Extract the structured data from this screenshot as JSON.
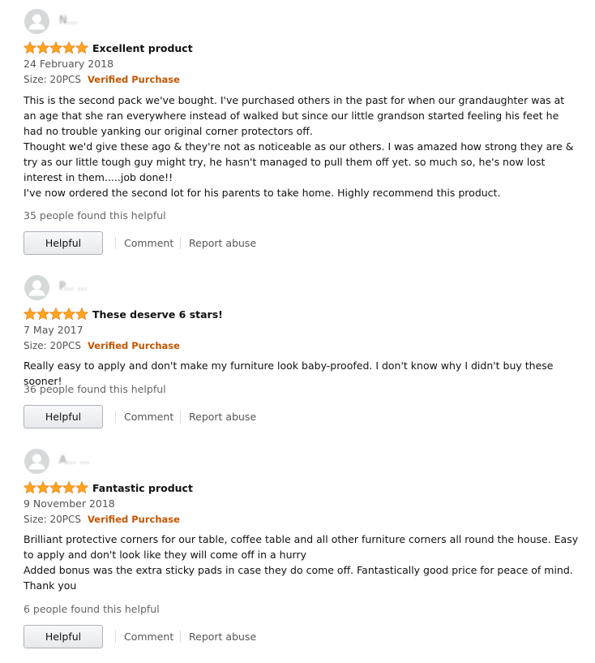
{
  "star_color": "#ffa41c",
  "verified_color": "#c45500",
  "reviews": [
    {
      "reviewer_name": "N...",
      "rating": 5,
      "title": "Excellent product",
      "date": "24 February 2018",
      "size": "Size: 20PCS",
      "verified": "Verified Purchase",
      "body": [
        "This is the second pack we've bought. I've purchased others in the past for when our grandaughter was at an age that she ran everywhere instead of walked but since our little grandson started feeling his feet he had no trouble yanking our original corner protectors off.",
        "Thought we'd give these ago & they're not as noticeable as our others. I was amazed how strong they are & try as our little tough guy might try, he hasn't managed to pull them off yet. so much so, he's now lost interest in them.....job done!!",
        "I've now ordered the second lot for his parents to take home. Highly recommend this product."
      ],
      "helpful_count": "35 people found this helpful",
      "helpful_label": "Helpful",
      "comment_label": "Comment",
      "report_label": "Report abuse"
    },
    {
      "reviewer_name": "P... ...",
      "rating": 5,
      "title": "These deserve 6 stars!",
      "date": "7 May 2017",
      "size": "Size: 20PCS",
      "verified": "Verified Purchase",
      "body": [
        "Really easy to apply and don't make my furniture look baby-proofed. I don't know why I didn't buy these sooner!"
      ],
      "helpful_count": "36 people found this helpful",
      "helpful_label": "Helpful",
      "comment_label": "Comment",
      "report_label": "Report abuse"
    },
    {
      "reviewer_name": "A... ...",
      "rating": 5,
      "title": "Fantastic product",
      "date": "9 November 2018",
      "size": "Size: 20PCS",
      "verified": "Verified Purchase",
      "body": [
        "Brilliant protective corners for our table, coffee table and all other furniture corners all round the house. Easy to apply and don't look like they will come off in a hurry",
        "Added bonus was the extra sticky pads in case they do come off. Fantastically good price for peace of mind. Thank you"
      ],
      "helpful_count": "6 people found this helpful",
      "helpful_label": "Helpful",
      "comment_label": "Comment",
      "report_label": "Report abuse"
    }
  ]
}
